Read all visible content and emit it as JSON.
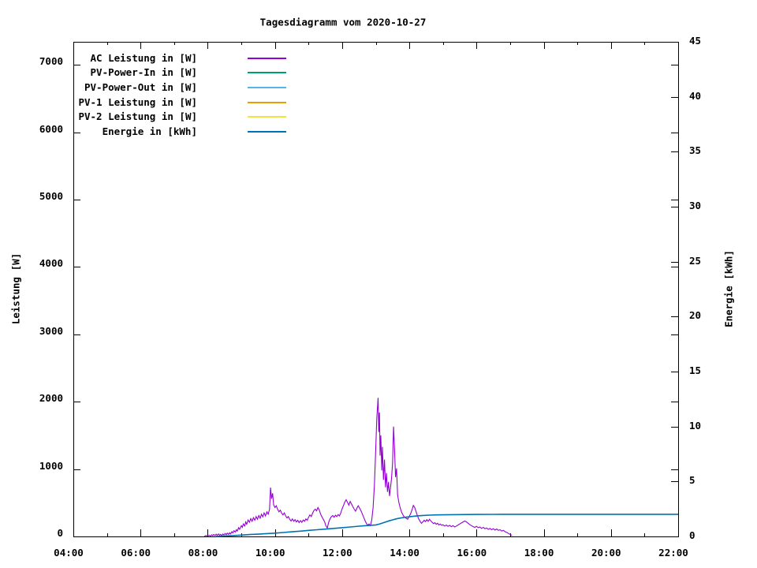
{
  "chart_data": {
    "type": "line",
    "title": "Tagesdiagramm vom 2020-10-27",
    "grid": false,
    "legend_position": "top-left-inside",
    "x_axis": {
      "unit": "time-of-day",
      "range_hours": [
        4,
        22
      ],
      "major_tick_hours": [
        4,
        6,
        8,
        10,
        12,
        14,
        16,
        18,
        20,
        22
      ],
      "minor_tick_hours": [
        5,
        7,
        9,
        11,
        13,
        15,
        17,
        19,
        21
      ],
      "tick_labels": [
        "04:00",
        "06:00",
        "08:00",
        "10:00",
        "12:00",
        "14:00",
        "16:00",
        "18:00",
        "20:00",
        "22:00"
      ]
    },
    "y_left_axis": {
      "label": "Leistung [W]",
      "range": [
        0,
        7342
      ],
      "ticks": [
        0,
        1000,
        2000,
        3000,
        4000,
        5000,
        6000,
        7000
      ],
      "tick_labels": [
        "0",
        "1000",
        "2000",
        "3000",
        "4000",
        "5000",
        "6000",
        "7000"
      ]
    },
    "y_right_axis": {
      "label": "Energie [kWh]",
      "range": [
        0,
        45
      ],
      "ticks": [
        0,
        5,
        10,
        15,
        20,
        25,
        30,
        35,
        40,
        45
      ],
      "tick_labels": [
        "0",
        "5",
        "10",
        "15",
        "20",
        "25",
        "30",
        "35",
        "40",
        "45"
      ]
    },
    "series": [
      {
        "label": "AC Leistung in [W]",
        "color": "#9400D3",
        "axis": "left",
        "points": [
          [
            7.9,
            3
          ],
          [
            7.95,
            15
          ],
          [
            8.0,
            5
          ],
          [
            8.05,
            18
          ],
          [
            8.08,
            6
          ],
          [
            8.12,
            24
          ],
          [
            8.15,
            10
          ],
          [
            8.18,
            30
          ],
          [
            8.22,
            12
          ],
          [
            8.25,
            34
          ],
          [
            8.28,
            16
          ],
          [
            8.32,
            38
          ],
          [
            8.35,
            18
          ],
          [
            8.38,
            30
          ],
          [
            8.42,
            14
          ],
          [
            8.45,
            36
          ],
          [
            8.48,
            22
          ],
          [
            8.52,
            44
          ],
          [
            8.55,
            26
          ],
          [
            8.58,
            50
          ],
          [
            8.62,
            30
          ],
          [
            8.65,
            55
          ],
          [
            8.68,
            38
          ],
          [
            8.72,
            70
          ],
          [
            8.75,
            52
          ],
          [
            8.78,
            85
          ],
          [
            8.82,
            65
          ],
          [
            8.85,
            100
          ],
          [
            8.88,
            80
          ],
          [
            8.92,
            130
          ],
          [
            8.95,
            105
          ],
          [
            9.0,
            160
          ],
          [
            9.03,
            135
          ],
          [
            9.06,
            185
          ],
          [
            9.1,
            155
          ],
          [
            9.13,
            215
          ],
          [
            9.16,
            180
          ],
          [
            9.2,
            245
          ],
          [
            9.24,
            210
          ],
          [
            9.28,
            265
          ],
          [
            9.32,
            225
          ],
          [
            9.36,
            280
          ],
          [
            9.4,
            240
          ],
          [
            9.44,
            295
          ],
          [
            9.48,
            255
          ],
          [
            9.52,
            310
          ],
          [
            9.56,
            270
          ],
          [
            9.6,
            330
          ],
          [
            9.64,
            290
          ],
          [
            9.68,
            350
          ],
          [
            9.72,
            305
          ],
          [
            9.76,
            365
          ],
          [
            9.8,
            330
          ],
          [
            9.84,
            400
          ],
          [
            9.87,
            726
          ],
          [
            9.9,
            560
          ],
          [
            9.93,
            640
          ],
          [
            9.96,
            470
          ],
          [
            10.0,
            430
          ],
          [
            10.04,
            455
          ],
          [
            10.08,
            400
          ],
          [
            10.12,
            365
          ],
          [
            10.16,
            390
          ],
          [
            10.2,
            345
          ],
          [
            10.24,
            320
          ],
          [
            10.28,
            350
          ],
          [
            10.32,
            305
          ],
          [
            10.36,
            275
          ],
          [
            10.4,
            295
          ],
          [
            10.44,
            255
          ],
          [
            10.48,
            230
          ],
          [
            10.52,
            260
          ],
          [
            10.56,
            225
          ],
          [
            10.6,
            250
          ],
          [
            10.64,
            215
          ],
          [
            10.68,
            240
          ],
          [
            10.72,
            205
          ],
          [
            10.76,
            235
          ],
          [
            10.8,
            210
          ],
          [
            10.84,
            245
          ],
          [
            10.88,
            225
          ],
          [
            10.92,
            260
          ],
          [
            10.96,
            240
          ],
          [
            11.0,
            285
          ],
          [
            11.04,
            320
          ],
          [
            11.08,
            295
          ],
          [
            11.12,
            345
          ],
          [
            11.16,
            385
          ],
          [
            11.2,
            405
          ],
          [
            11.24,
            380
          ],
          [
            11.28,
            430
          ],
          [
            11.32,
            395
          ],
          [
            11.36,
            330
          ],
          [
            11.4,
            290
          ],
          [
            11.44,
            255
          ],
          [
            11.48,
            215
          ],
          [
            11.52,
            155
          ],
          [
            11.56,
            125
          ],
          [
            11.6,
            210
          ],
          [
            11.64,
            260
          ],
          [
            11.68,
            295
          ],
          [
            11.72,
            310
          ],
          [
            11.76,
            285
          ],
          [
            11.8,
            315
          ],
          [
            11.84,
            295
          ],
          [
            11.88,
            325
          ],
          [
            11.92,
            305
          ],
          [
            11.96,
            350
          ],
          [
            12.0,
            410
          ],
          [
            12.04,
            460
          ],
          [
            12.08,
            510
          ],
          [
            12.12,
            545
          ],
          [
            12.16,
            505
          ],
          [
            12.2,
            465
          ],
          [
            12.24,
            520
          ],
          [
            12.28,
            480
          ],
          [
            12.32,
            440
          ],
          [
            12.36,
            405
          ],
          [
            12.4,
            375
          ],
          [
            12.44,
            420
          ],
          [
            12.48,
            455
          ],
          [
            12.52,
            420
          ],
          [
            12.56,
            380
          ],
          [
            12.6,
            335
          ],
          [
            12.64,
            285
          ],
          [
            12.68,
            235
          ],
          [
            12.72,
            195
          ],
          [
            12.76,
            165
          ],
          [
            12.8,
            185
          ],
          [
            12.84,
            160
          ],
          [
            12.88,
            240
          ],
          [
            12.92,
            420
          ],
          [
            12.96,
            760
          ],
          [
            13.0,
            1300
          ],
          [
            13.03,
            1750
          ],
          [
            13.07,
            2057
          ],
          [
            13.09,
            1550
          ],
          [
            13.11,
            1840
          ],
          [
            13.13,
            1200
          ],
          [
            13.15,
            1500
          ],
          [
            13.18,
            980
          ],
          [
            13.2,
            1330
          ],
          [
            13.23,
            840
          ],
          [
            13.26,
            1140
          ],
          [
            13.29,
            730
          ],
          [
            13.32,
            940
          ],
          [
            13.35,
            660
          ],
          [
            13.38,
            810
          ],
          [
            13.41,
            600
          ],
          [
            13.44,
            720
          ],
          [
            13.47,
            860
          ],
          [
            13.5,
            1080
          ],
          [
            13.53,
            1630
          ],
          [
            13.56,
            1280
          ],
          [
            13.59,
            880
          ],
          [
            13.62,
            1010
          ],
          [
            13.65,
            620
          ],
          [
            13.69,
            500
          ],
          [
            13.73,
            420
          ],
          [
            13.77,
            360
          ],
          [
            13.81,
            320
          ],
          [
            13.85,
            290
          ],
          [
            13.9,
            270
          ],
          [
            13.95,
            255
          ],
          [
            14.0,
            300
          ],
          [
            14.04,
            340
          ],
          [
            14.08,
            395
          ],
          [
            14.12,
            460
          ],
          [
            14.16,
            430
          ],
          [
            14.2,
            370
          ],
          [
            14.24,
            310
          ],
          [
            14.28,
            260
          ],
          [
            14.32,
            225
          ],
          [
            14.36,
            195
          ],
          [
            14.4,
            215
          ],
          [
            14.44,
            240
          ],
          [
            14.48,
            220
          ],
          [
            14.52,
            250
          ],
          [
            14.56,
            225
          ],
          [
            14.6,
            255
          ],
          [
            14.64,
            230
          ],
          [
            14.68,
            210
          ],
          [
            14.72,
            190
          ],
          [
            14.76,
            205
          ],
          [
            14.8,
            180
          ],
          [
            14.84,
            195
          ],
          [
            14.88,
            170
          ],
          [
            14.92,
            185
          ],
          [
            14.96,
            165
          ],
          [
            15.0,
            175
          ],
          [
            15.05,
            155
          ],
          [
            15.1,
            170
          ],
          [
            15.15,
            150
          ],
          [
            15.2,
            165
          ],
          [
            15.25,
            145
          ],
          [
            15.3,
            160
          ],
          [
            15.35,
            140
          ],
          [
            15.4,
            155
          ],
          [
            15.45,
            170
          ],
          [
            15.5,
            185
          ],
          [
            15.55,
            200
          ],
          [
            15.6,
            215
          ],
          [
            15.65,
            230
          ],
          [
            15.7,
            215
          ],
          [
            15.75,
            195
          ],
          [
            15.8,
            175
          ],
          [
            15.85,
            160
          ],
          [
            15.9,
            145
          ],
          [
            15.95,
            135
          ],
          [
            16.0,
            150
          ],
          [
            16.05,
            130
          ],
          [
            16.1,
            140
          ],
          [
            16.15,
            120
          ],
          [
            16.2,
            135
          ],
          [
            16.25,
            115
          ],
          [
            16.3,
            125
          ],
          [
            16.35,
            105
          ],
          [
            16.4,
            120
          ],
          [
            16.45,
            100
          ],
          [
            16.5,
            115
          ],
          [
            16.55,
            95
          ],
          [
            16.6,
            110
          ],
          [
            16.65,
            90
          ],
          [
            16.7,
            100
          ],
          [
            16.75,
            80
          ],
          [
            16.8,
            90
          ],
          [
            16.85,
            70
          ],
          [
            16.9,
            60
          ],
          [
            16.95,
            45
          ],
          [
            17.0,
            30
          ],
          [
            17.05,
            15
          ]
        ]
      },
      {
        "label": "PV-Power-In in [W]",
        "color": "#009E73",
        "axis": "left",
        "points": []
      },
      {
        "label": "PV-Power-Out in [W]",
        "color": "#56B4E9",
        "axis": "left",
        "points": []
      },
      {
        "label": "PV-1 Leistung in [W]",
        "color": "#E69F00",
        "axis": "left",
        "points": []
      },
      {
        "label": "PV-2 Leistung in [W]",
        "color": "#F0E442",
        "axis": "left",
        "points": []
      },
      {
        "label": "Energie in [kWh]",
        "color": "#0072B2",
        "axis": "right",
        "points": [
          [
            8.25,
            0.01
          ],
          [
            8.5,
            0.04
          ],
          [
            8.75,
            0.08
          ],
          [
            9.0,
            0.12
          ],
          [
            9.25,
            0.17
          ],
          [
            9.5,
            0.21
          ],
          [
            9.75,
            0.26
          ],
          [
            10.0,
            0.3
          ],
          [
            10.25,
            0.36
          ],
          [
            10.5,
            0.42
          ],
          [
            10.75,
            0.48
          ],
          [
            11.0,
            0.55
          ],
          [
            11.25,
            0.61
          ],
          [
            11.5,
            0.67
          ],
          [
            11.75,
            0.73
          ],
          [
            12.0,
            0.8
          ],
          [
            12.25,
            0.86
          ],
          [
            12.5,
            0.93
          ],
          [
            12.75,
            0.99
          ],
          [
            13.0,
            1.05
          ],
          [
            13.1,
            1.12
          ],
          [
            13.2,
            1.22
          ],
          [
            13.3,
            1.32
          ],
          [
            13.4,
            1.42
          ],
          [
            13.5,
            1.51
          ],
          [
            13.6,
            1.59
          ],
          [
            13.7,
            1.66
          ],
          [
            13.8,
            1.71
          ],
          [
            13.9,
            1.75
          ],
          [
            14.0,
            1.79
          ],
          [
            14.2,
            1.86
          ],
          [
            14.4,
            1.91
          ],
          [
            14.6,
            1.94
          ],
          [
            14.8,
            1.96
          ],
          [
            15.0,
            1.97
          ],
          [
            15.5,
            1.99
          ],
          [
            16.0,
            2.0
          ],
          [
            16.5,
            2.01
          ],
          [
            17.0,
            2.02
          ],
          [
            18.0,
            2.02
          ],
          [
            19.0,
            2.02
          ],
          [
            20.0,
            2.02
          ],
          [
            21.0,
            2.02
          ],
          [
            22.0,
            2.02
          ]
        ]
      }
    ]
  }
}
